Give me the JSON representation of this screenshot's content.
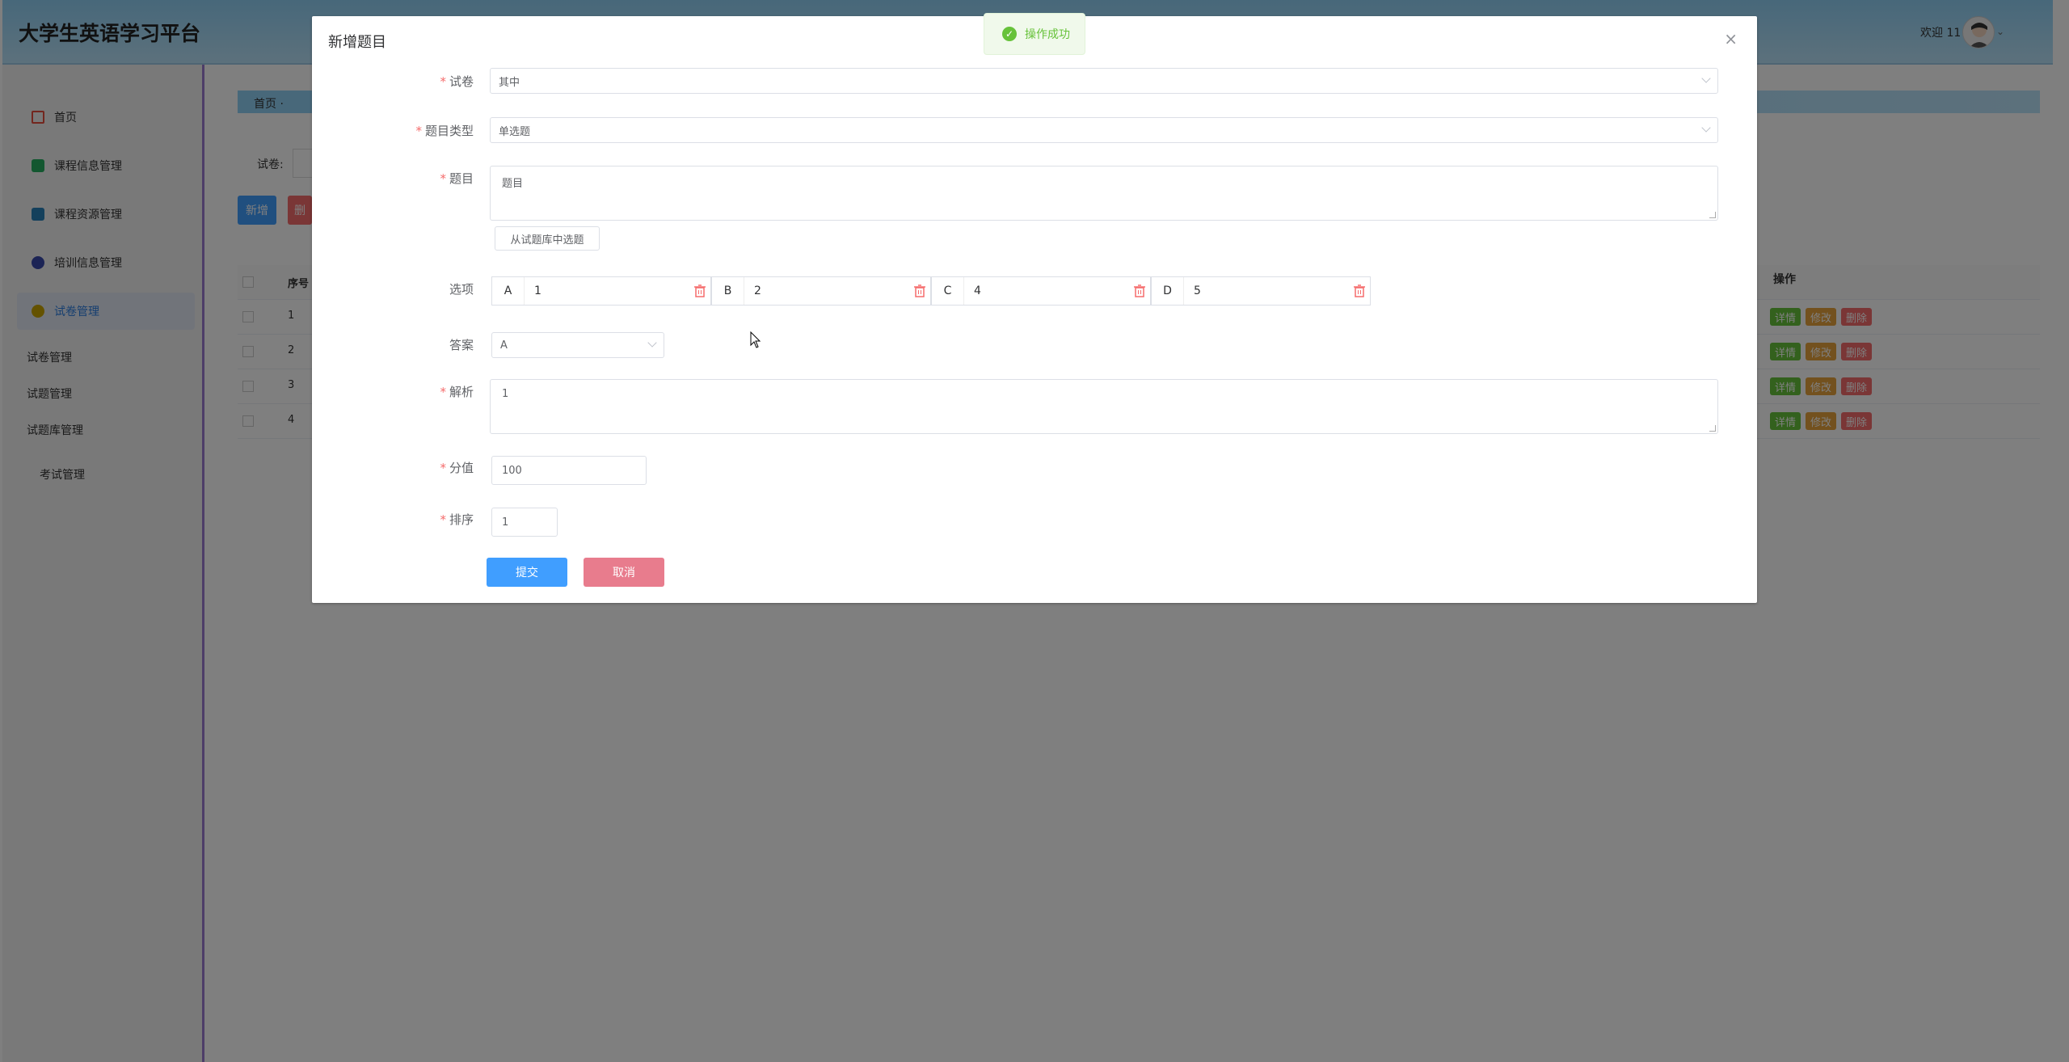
{
  "app": {
    "title": "大学生英语学习平台",
    "welcome": "欢迎 11"
  },
  "sidebar": {
    "items": [
      {
        "label": "首页",
        "color": "#e74c3c"
      },
      {
        "label": "课程信息管理",
        "color": "#27ae60"
      },
      {
        "label": "课程资源管理",
        "color": "#2980b9"
      },
      {
        "label": "培训信息管理",
        "color": "#3949ab"
      },
      {
        "label": "试卷管理",
        "color": "#c9a400"
      }
    ],
    "sub_items": [
      "试卷管理",
      "试题管理",
      "试题库管理",
      "考试管理"
    ]
  },
  "background": {
    "breadcrumb": "首页 ·",
    "search_label": "试卷:",
    "add_button": "新增",
    "delete_button": "删",
    "table": {
      "header_index": "序号",
      "header_ops": "操作",
      "rows": [
        "1",
        "2",
        "3",
        "4"
      ],
      "op_labels": [
        "详情",
        "修改",
        "删除"
      ]
    }
  },
  "toast": {
    "message": "操作成功"
  },
  "dialog": {
    "title": "新增题目",
    "close": "×",
    "fields": {
      "paper_label": "试卷",
      "paper_value": "其中",
      "type_label": "题目类型",
      "type_value": "单选题",
      "question_label": "题目",
      "question_value": "题目",
      "pick_from_bank": "从试题库中选题",
      "options_label": "选项",
      "options": [
        {
          "letter": "A",
          "value": "1"
        },
        {
          "letter": "B",
          "value": "2"
        },
        {
          "letter": "C",
          "value": "4"
        },
        {
          "letter": "D",
          "value": "5"
        }
      ],
      "answer_label": "答案",
      "answer_value": "A",
      "analysis_label": "解析",
      "analysis_value": "1",
      "score_label": "分值",
      "score_value": "100",
      "order_label": "排序",
      "order_value": "1"
    },
    "submit": "提交",
    "cancel": "取消"
  },
  "colors": {
    "primary": "#409eff",
    "danger": "#e87c8d",
    "success": "#67c23a",
    "warning": "#e6a23c"
  }
}
